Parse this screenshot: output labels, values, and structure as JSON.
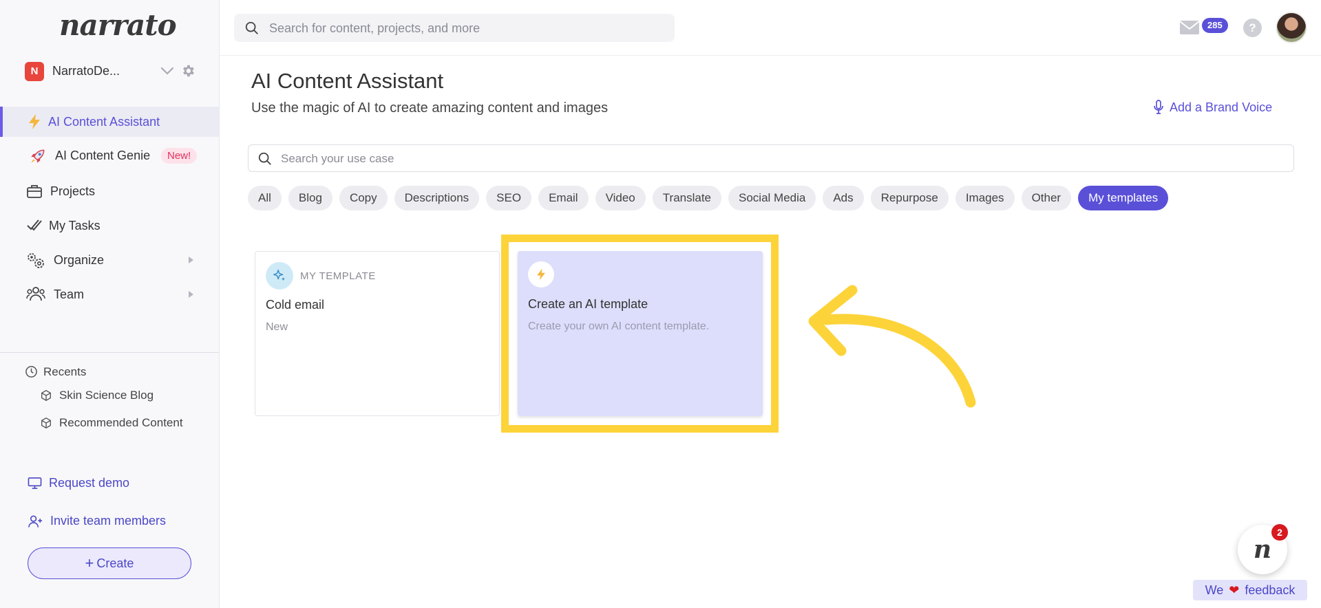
{
  "sidebar": {
    "logo": "narrato",
    "workspace": {
      "initial": "N",
      "name": "NarratoDe..."
    },
    "items": [
      {
        "label": "AI Content Assistant",
        "icon": "lightning-icon",
        "active": true
      },
      {
        "label": "AI Content Genie",
        "icon": "rocket-icon",
        "badge": "New!"
      },
      {
        "label": "Projects",
        "icon": "briefcase-icon"
      },
      {
        "label": "My Tasks",
        "icon": "checkmark-icon"
      },
      {
        "label": "Organize",
        "icon": "gears-icon",
        "has_arrow": true
      },
      {
        "label": "Team",
        "icon": "team-icon",
        "has_arrow": true
      }
    ],
    "recents": {
      "label": "Recents",
      "items": [
        {
          "label": "Skin Science Blog",
          "icon": "cube-icon"
        },
        {
          "label": "Recommended Content",
          "icon": "cube-icon"
        }
      ]
    },
    "request_demo": "Request demo",
    "invite": "Invite team members",
    "create": "Create"
  },
  "topbar": {
    "search_placeholder": "Search for content, projects, and more",
    "mail_count": "285"
  },
  "main": {
    "title": "AI Content Assistant",
    "subtitle": "Use the magic of AI to create amazing content and images",
    "brand_voice": "Add a Brand Voice",
    "usecase_placeholder": "Search your use case",
    "chips": [
      "All",
      "Blog",
      "Copy",
      "Descriptions",
      "SEO",
      "Email",
      "Video",
      "Translate",
      "Social Media",
      "Ads",
      "Repurpose",
      "Images",
      "Other",
      "My templates"
    ],
    "active_chip": "My templates",
    "cards": [
      {
        "kicker": "MY TEMPLATE",
        "name": "Cold email",
        "desc": "New"
      },
      {
        "name": "Create an AI template",
        "desc": "Create your own AI content template."
      }
    ]
  },
  "chat": {
    "count": "2"
  },
  "feedback": {
    "prefix": "We",
    "suffix": "feedback"
  },
  "colors": {
    "accent": "#5a50d8",
    "highlight": "#fdd33a",
    "badge_red": "#d7191f",
    "workspace_red": "#e8453c"
  }
}
